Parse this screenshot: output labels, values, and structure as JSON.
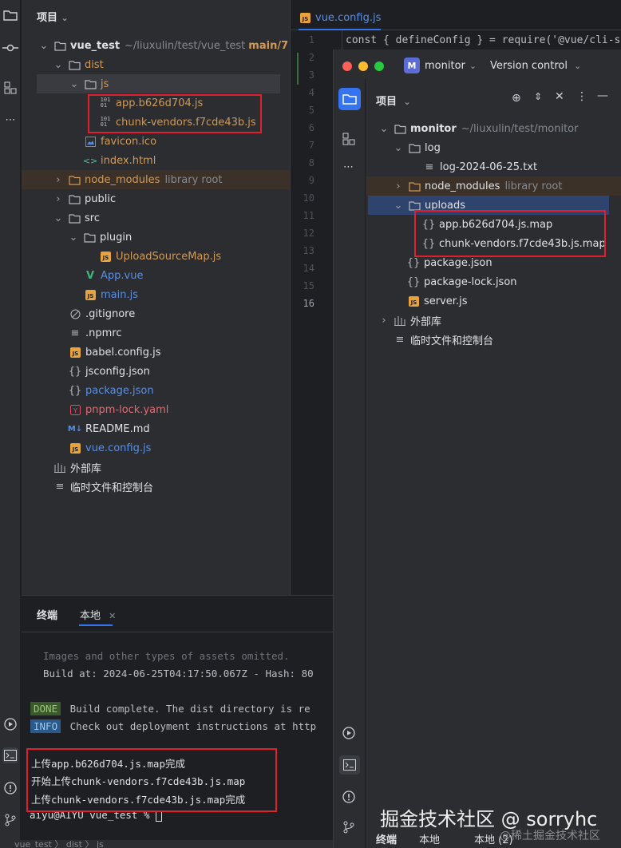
{
  "project_panel": {
    "title": "项目",
    "root": {
      "name": "vue_test",
      "path": "~/liuxulin/test/vue_test",
      "branch": "main/7 Δ"
    },
    "items": [
      {
        "label": "dist"
      },
      {
        "label": "js"
      },
      {
        "label": "app.b626d704.js"
      },
      {
        "label": "chunk-vendors.f7cde43b.js"
      },
      {
        "label": "favicon.ico"
      },
      {
        "label": "index.html"
      },
      {
        "label": "node_modules",
        "note": "library root"
      },
      {
        "label": "public"
      },
      {
        "label": "src"
      },
      {
        "label": "plugin"
      },
      {
        "label": "UploadSourceMap.js"
      },
      {
        "label": "App.vue"
      },
      {
        "label": "main.js"
      },
      {
        "label": ".gitignore"
      },
      {
        "label": ".npmrc"
      },
      {
        "label": "babel.config.js"
      },
      {
        "label": "jsconfig.json"
      },
      {
        "label": "package.json"
      },
      {
        "label": "pnpm-lock.yaml"
      },
      {
        "label": "README.md"
      },
      {
        "label": "vue.config.js"
      },
      {
        "label": "外部库"
      },
      {
        "label": "临时文件和控制台"
      }
    ]
  },
  "editor": {
    "tab": "vue.config.js",
    "code_line": "const { defineConfig } = require('@vue/cli-se",
    "line_numbers": [
      "1",
      "2",
      "3",
      "4",
      "5",
      "6",
      "7",
      "8",
      "9",
      "10",
      "11",
      "12",
      "13",
      "14",
      "15",
      "16"
    ]
  },
  "terminal": {
    "tab_terminal": "终端",
    "tab_local": "本地",
    "lines": {
      "assets": "Images and other types of assets omitted.",
      "build_at": "Build at: 2024-06-25T04:17:50.067Z - Hash: 80",
      "done_badge": "DONE",
      "done_text": "Build complete. The dist directory is re",
      "info_badge": "INFO",
      "info_text": "Check out deployment instructions at http",
      "up1": "上传app.b626d704.js.map完成",
      "up2": "开始上传chunk-vendors.f7cde43b.js.map",
      "up3": "上传chunk-vendors.f7cde43b.js.map完成",
      "prompt": "aiyu@AIYU vue_test % "
    }
  },
  "status_bar": {
    "crumbs": "vue_test 〉 dist 〉 js"
  },
  "monitor_window": {
    "project_badge": "M",
    "project_name": "monitor",
    "vcs": "Version control",
    "panel_title": "项目",
    "root": {
      "name": "monitor",
      "path": "~/liuxulin/test/monitor"
    },
    "items": [
      {
        "label": "log"
      },
      {
        "label": "log-2024-06-25.txt"
      },
      {
        "label": "node_modules",
        "note": "library root"
      },
      {
        "label": "uploads"
      },
      {
        "label": "app.b626d704.js.map"
      },
      {
        "label": "chunk-vendors.f7cde43b.js.map"
      },
      {
        "label": "package.json"
      },
      {
        "label": "package-lock.json"
      },
      {
        "label": "server.js"
      },
      {
        "label": "外部库"
      },
      {
        "label": "临时文件和控制台"
      }
    ],
    "bottom_tabs": {
      "terminal": "终端",
      "local": "本地",
      "local2": "本地 (2)"
    }
  },
  "watermark": {
    "main": "掘金技术社区 @ sorryhc",
    "sub": "@稀土掘金技术社区"
  },
  "colors": {
    "accent": "#3574f0",
    "highlight_box": "#e0202f",
    "js_icon": "#e8a33d",
    "folder": "#b6b9bf"
  }
}
